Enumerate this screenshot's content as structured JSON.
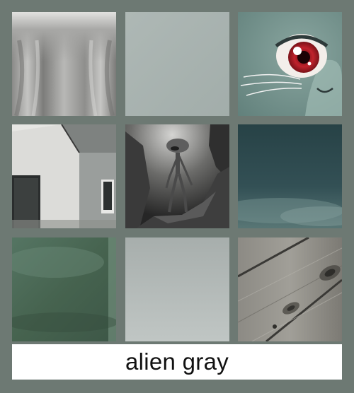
{
  "palette": {
    "name": "alien gray",
    "background": "#6d7973"
  },
  "swatches": [
    {
      "subject": "draped-gray-fabric",
      "color": "#9c9c9a"
    },
    {
      "subject": "solid-pale-gray",
      "color": "#a9b4b1"
    },
    {
      "subject": "cartoon-cat-eye",
      "color": "#7a9490"
    },
    {
      "subject": "whitewashed-cottage",
      "color": "#c9c9c6"
    },
    {
      "subject": "alien-on-rocks",
      "color": "#6b6b6b"
    },
    {
      "subject": "dark-teal-sky",
      "color": "#2f4a4c"
    },
    {
      "subject": "glossy-green-gray",
      "color": "#4a6858"
    },
    {
      "subject": "soft-gray-gradient",
      "color": "#b3bab8"
    },
    {
      "subject": "weathered-wood",
      "color": "#8e8c86"
    }
  ]
}
